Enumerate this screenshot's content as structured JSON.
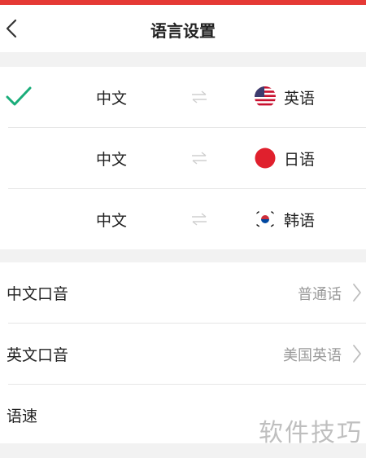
{
  "header": {
    "title": "语言设置"
  },
  "language_pairs": [
    {
      "from": "中文",
      "to": "英语",
      "flag_icon": "us-flag-icon",
      "selected": true
    },
    {
      "from": "中文",
      "to": "日语",
      "flag_icon": "japan-flag-icon",
      "selected": false
    },
    {
      "from": "中文",
      "to": "韩语",
      "flag_icon": "korea-flag-icon",
      "selected": false
    }
  ],
  "settings": [
    {
      "label": "中文口音",
      "value": "普通话"
    },
    {
      "label": "英文口音",
      "value": "美国英语"
    },
    {
      "label": "语速"
    }
  ],
  "watermark": "软件技巧",
  "colors": {
    "accent_red": "#e53935",
    "check_green": "#1aad7a",
    "value_gray": "#9a9a9a",
    "background": "#f2f2f2"
  }
}
